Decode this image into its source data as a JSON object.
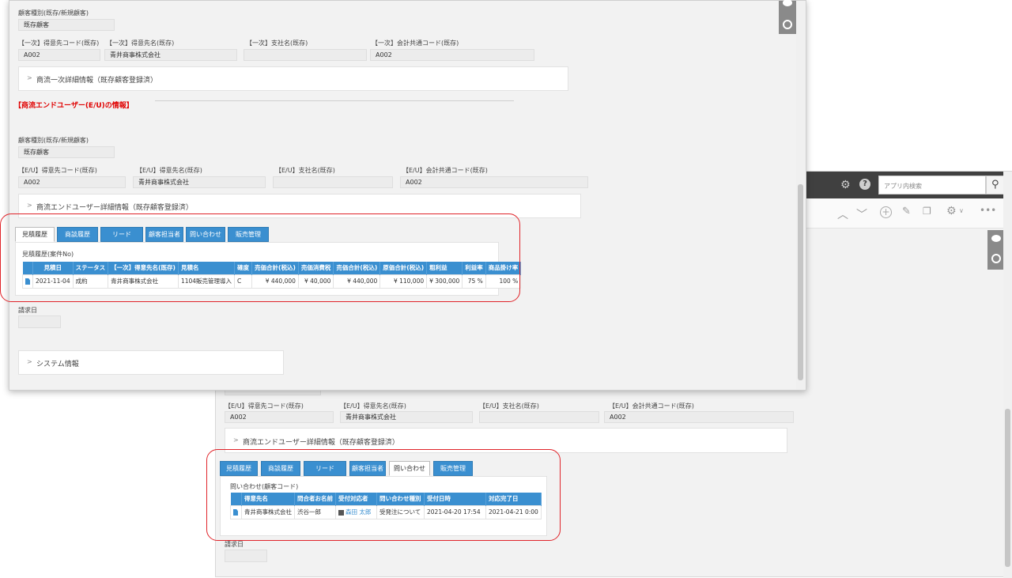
{
  "back": {
    "toolbar": {
      "search_placeholder": "アプリ内検索",
      "icons": [
        "gear-icon",
        "help-icon",
        "search-icon",
        "up-icon",
        "down-icon",
        "plus-icon",
        "edit-icon",
        "copy-icon",
        "gear-icon",
        "more-icon"
      ]
    },
    "ids": {
      "code_label": "【E/U】得意先コード(既存)",
      "code_value": "A002",
      "name_label": "【E/U】得意先名(既存)",
      "name_value": "青井商事株式会社",
      "branch_label": "【E/U】支社名(既存)",
      "branch_value": "",
      "account_label": "【E/U】会計共通コード(既存)",
      "account_value": "A002"
    },
    "detail_label": "商流エンドユーザー詳細情報（既存顧客登録済）",
    "tabs": [
      "見積履歴",
      "商談履歴",
      "リード",
      "顧客担当者",
      "問い合わせ",
      "販売管理"
    ],
    "active_tab": 4,
    "table_title": "問い合わせ(顧客コード)",
    "headers": [
      "得意先名",
      "問合者お名前",
      "受付対応者",
      "問い合わせ種別",
      "受付日時",
      "対応完了日"
    ],
    "rows": [
      [
        "青井商事株式会社",
        "渋谷一郎",
        "森田 太郎",
        "受発注について",
        "2021-04-20 17:54",
        "2021-04-21 0:00"
      ]
    ],
    "invoice_label": "請求日"
  },
  "front": {
    "customer_type_label": "顧客種別(既存/新規顧客)",
    "customer_type_value": "既存顧客",
    "primary": {
      "code_label": "【一次】得意先コード(既存)",
      "code_value": "A002",
      "name_label": "【一次】得意先名(既存)",
      "name_value": "青井商事株式会社",
      "branch_label": "【一次】支社名(既存)",
      "branch_value": "",
      "account_label": "【一次】会計共通コード(既存)",
      "account_value": "A002"
    },
    "primary_detail": "商流一次詳細情報（既存顧客登録済）",
    "eu_section_title": "【商流エンドユーザー(E/U)の情報】",
    "eu_customer_type_label": "顧客種別(既存/新規顧客)",
    "eu_customer_type_value": "既存顧客",
    "eu": {
      "code_label": "【E/U】得意先コード(既存)",
      "code_value": "A002",
      "name_label": "【E/U】得意先名(既存)",
      "name_value": "青井商事株式会社",
      "branch_label": "【E/U】支社名(既存)",
      "branch_value": "",
      "account_label": "【E/U】会計共通コード(既存)",
      "account_value": "A002"
    },
    "eu_detail": "商流エンドユーザー詳細情報（既存顧客登録済）",
    "tabs": [
      "見積履歴",
      "商談履歴",
      "リード",
      "顧客担当者",
      "問い合わせ",
      "販売管理"
    ],
    "active_tab": 0,
    "table_title": "見積履歴(案件No)",
    "headers": [
      "見積日",
      "ステータス",
      "【一次】得意先名(既存)",
      "見積名",
      "確度",
      "売価合計(税込)",
      "売価消費税",
      "売価合計(税込)",
      "原価合計(税込)",
      "粗利益",
      "利益率",
      "商品掛け率"
    ],
    "rows": [
      [
        "2021-11-04",
        "成約",
        "青井商事株式会社",
        "1104販売管理導入",
        "C",
        "¥ 440,000",
        "¥ 40,000",
        "¥ 440,000",
        "¥ 110,000",
        "¥ 300,000",
        "75 %",
        "100 %"
      ]
    ],
    "invoice_label": "請求日",
    "system_info": "システム情報"
  },
  "colors": {
    "accent": "#3a8fd0",
    "highlight": "#e0242a",
    "section_title": "#e00000"
  }
}
